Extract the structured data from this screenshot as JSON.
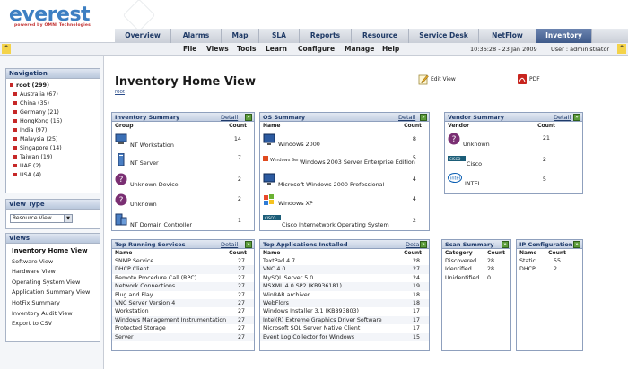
{
  "header": {
    "logo": "everest",
    "logo_sub": "powered by OMNI Technologies",
    "tabs": [
      {
        "label": "Overview",
        "active": false
      },
      {
        "label": "Alarms",
        "active": false
      },
      {
        "label": "Map",
        "active": false
      },
      {
        "label": "SLA",
        "active": false
      },
      {
        "label": "Reports",
        "active": false
      },
      {
        "label": "Resource",
        "active": false
      },
      {
        "label": "Service Desk",
        "active": false
      },
      {
        "label": "NetFlow",
        "active": false
      },
      {
        "label": "Inventory",
        "active": true
      }
    ],
    "menu": [
      "File",
      "Views",
      "Tools",
      "Learn",
      "Configure",
      "Manage",
      "Help"
    ],
    "clock": "10:36:28 - 23 Jan 2009",
    "user": "User : administrator"
  },
  "sidebar": {
    "navigation_title": "Navigation",
    "root": "root (299)",
    "tree": [
      "Australia (67)",
      "China (35)",
      "Germany (21)",
      "HongKong (15)",
      "India (97)",
      "Malaysia (25)",
      "Singapore (14)",
      "Taiwan (19)",
      "UAE (2)",
      "USA (4)"
    ],
    "view_type_title": "View Type",
    "view_type_value": "Resource View",
    "views_title": "Views",
    "views": [
      "Inventory Home View",
      "Software View",
      "Hardware View",
      "Operating System View",
      "Application Summary View",
      "HotFix Summary",
      "Inventory Audit View",
      "Export to CSV"
    ]
  },
  "main": {
    "title": "Inventory Home View",
    "breadcrumb": "root",
    "edit_view": "Edit View",
    "pdf": "PDF",
    "detail_label": "Detail",
    "go_label": "»",
    "inventory_summary": {
      "title": "Inventory Summary",
      "col1": "Group",
      "col2": "Count",
      "rows": [
        {
          "name": "NT Workstation",
          "count": "14"
        },
        {
          "name": "NT Server",
          "count": "7"
        },
        {
          "name": "Unknown Device",
          "count": "2"
        },
        {
          "name": "Unknown",
          "count": "2"
        },
        {
          "name": "NT Domain Controller",
          "count": "1"
        }
      ]
    },
    "os_summary": {
      "title": "OS Summary",
      "col1": "Name",
      "col2": "Count",
      "rows": [
        {
          "name": "Windows 2000",
          "count": "8"
        },
        {
          "name": "Windows 2003 Server Enterprise Edition",
          "count": "5"
        },
        {
          "name": "Microsoft Windows 2000 Professional",
          "count": "4"
        },
        {
          "name": "Windows XP",
          "count": "4"
        },
        {
          "name": "Cisco Internetwork Operating System",
          "count": "2"
        }
      ]
    },
    "vendor_summary": {
      "title": "Vendor Summary",
      "col1": "Vendor",
      "col2": "Count",
      "rows": [
        {
          "name": "Unknown",
          "count": "21"
        },
        {
          "name": "Cisco",
          "count": "2"
        },
        {
          "name": "INTEL",
          "count": "5"
        }
      ]
    },
    "top_services": {
      "title": "Top Running Services",
      "col1": "Name",
      "col2": "Count",
      "rows": [
        {
          "name": "SNMP Service",
          "count": "27"
        },
        {
          "name": "DHCP Client",
          "count": "27"
        },
        {
          "name": "Remote Procedure Call (RPC)",
          "count": "27"
        },
        {
          "name": "Network Connections",
          "count": "27"
        },
        {
          "name": "Plug and Play",
          "count": "27"
        },
        {
          "name": "VNC Server Version 4",
          "count": "27"
        },
        {
          "name": "Workstation",
          "count": "27"
        },
        {
          "name": "Windows Management Instrumentation",
          "count": "27"
        },
        {
          "name": "Protected Storage",
          "count": "27"
        },
        {
          "name": "Server",
          "count": "27"
        }
      ]
    },
    "top_apps": {
      "title": "Top Applications Installed",
      "col1": "Name",
      "col2": "Count",
      "rows": [
        {
          "name": "TextPad 4.7",
          "count": "28"
        },
        {
          "name": "VNC 4.0",
          "count": "27"
        },
        {
          "name": "MySQL Server 5.0",
          "count": "24"
        },
        {
          "name": "MSXML 4.0 SP2 (KB936181)",
          "count": "19"
        },
        {
          "name": "WinRAR archiver",
          "count": "18"
        },
        {
          "name": "WebFldrs",
          "count": "18"
        },
        {
          "name": "Windows Installer 3.1 (KB893803)",
          "count": "17"
        },
        {
          "name": "Intel(R) Extreme Graphics Driver Software",
          "count": "17"
        },
        {
          "name": "Microsoft SQL Server Native Client",
          "count": "17"
        },
        {
          "name": "Event Log Collector for Windows",
          "count": "15"
        }
      ]
    },
    "scan_summary": {
      "title": "Scan Summary",
      "col1": "Category",
      "col2": "Count",
      "rows": [
        {
          "name": "Discovered",
          "count": "28"
        },
        {
          "name": "Identified",
          "count": "28"
        },
        {
          "name": "Unidentified",
          "count": "0"
        }
      ]
    },
    "ip_config": {
      "title": "IP Configuration",
      "col1": "Name",
      "col2": "Count",
      "rows": [
        {
          "name": "Static",
          "count": "55"
        },
        {
          "name": "DHCP",
          "count": "2"
        }
      ]
    }
  }
}
